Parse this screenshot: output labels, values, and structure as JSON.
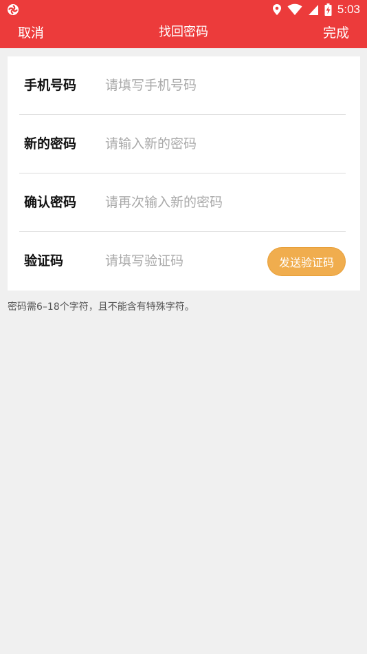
{
  "status_bar": {
    "time": "5:03",
    "icons": [
      "app-logo-icon",
      "location-icon",
      "wifi-icon",
      "signal-icon",
      "battery-charging-icon"
    ]
  },
  "toolbar": {
    "cancel_label": "取消",
    "title": "找回密码",
    "done_label": "完成"
  },
  "form": {
    "phone": {
      "label": "手机号码",
      "placeholder": "请填写手机号码",
      "value": ""
    },
    "new_password": {
      "label": "新的密码",
      "placeholder": "请输入新的密码",
      "value": ""
    },
    "confirm_password": {
      "label": "确认密码",
      "placeholder": "请再次输入新的密码",
      "value": ""
    },
    "code": {
      "label": "验证码",
      "placeholder": "请填写验证码",
      "value": "",
      "send_label": "发送验证码"
    }
  },
  "hint": "密码需6–18个字符，且不能含有特殊字符。",
  "colors": {
    "brand_red": "#ec3b3b",
    "send_button": "#f0ad4e",
    "background": "#f0f0f0"
  }
}
